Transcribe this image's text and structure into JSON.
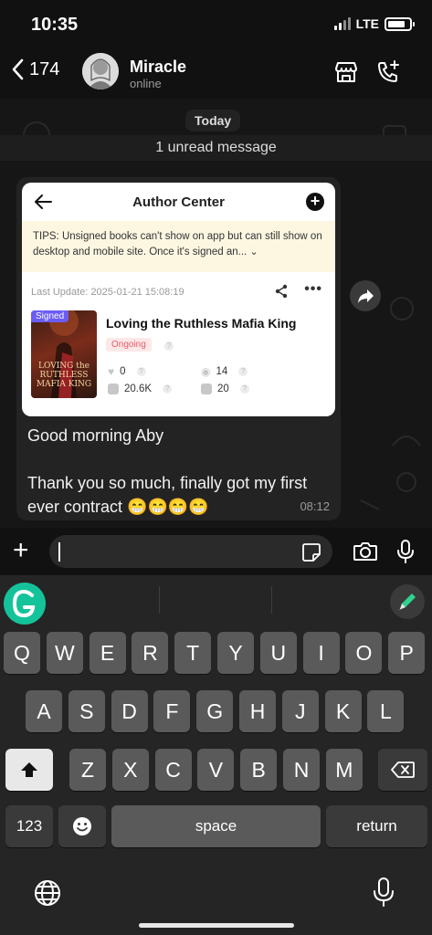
{
  "status_bar": {
    "time": "10:35",
    "network": "LTE",
    "battery_level": 0.8
  },
  "header": {
    "back_count": "174",
    "contact_name": "Miracle",
    "contact_status": "online"
  },
  "chat": {
    "date_chip": "Today",
    "unread_label": "1 unread message",
    "image": {
      "title": "Author Center",
      "tips": "TIPS: Unsigned books can't show on app but can still show on desktop and mobile site. Once it's signed an...",
      "last_update": "Last Update: 2025-01-21 15:08:19",
      "cover_badge": "Signed",
      "cover_text": "LOVING the RUTHLESS MAFIA KING",
      "book_title": "Loving the Ruthless Mafia King",
      "status": "Ongoing",
      "stats": {
        "likes": "0",
        "views": "14",
        "words": "20.6K",
        "chapters": "20"
      }
    },
    "message": {
      "line1": "Good morning Aby",
      "line2": "Thank you so much, finally got my first ever contract 😁😁😁😁",
      "time": "08:12"
    }
  },
  "keyboard": {
    "row1": [
      "Q",
      "W",
      "E",
      "R",
      "T",
      "Y",
      "U",
      "I",
      "O",
      "P"
    ],
    "row2": [
      "A",
      "S",
      "D",
      "F",
      "G",
      "H",
      "J",
      "K",
      "L"
    ],
    "row3": [
      "Z",
      "X",
      "C",
      "V",
      "B",
      "N",
      "M"
    ],
    "numbers_label": "123",
    "space_label": "space",
    "return_label": "return"
  },
  "colors": {
    "grammarly_green": "#15c39a",
    "signed_badge": "#6b5cf6",
    "ongoing_text": "#e35d6a"
  }
}
